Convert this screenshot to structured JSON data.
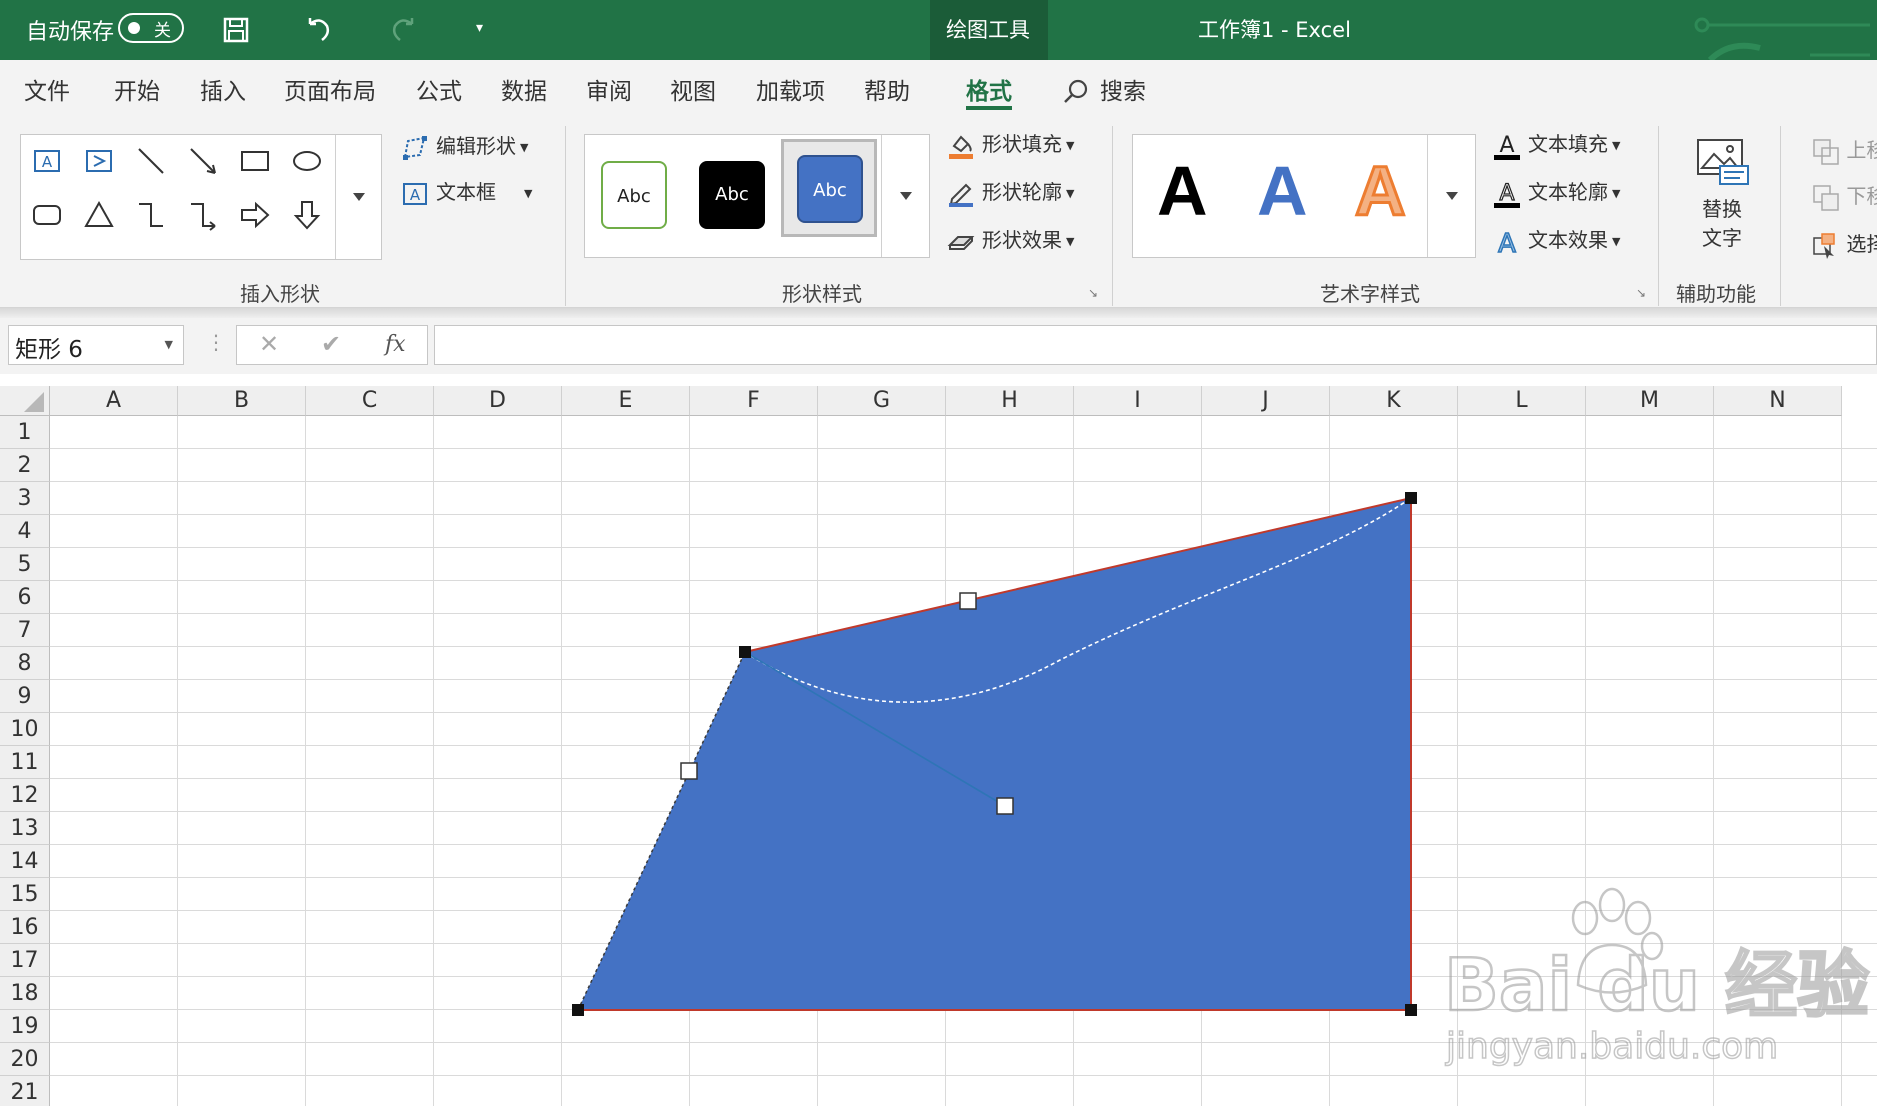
{
  "title_bar": {
    "autosave_label": "自动保存",
    "autosave_state": "关",
    "context_tab": "绘图工具",
    "document_title": "工作簿1  -  Excel"
  },
  "menu_tabs": [
    "文件",
    "开始",
    "插入",
    "页面布局",
    "公式",
    "数据",
    "审阅",
    "视图",
    "加载项",
    "帮助",
    "格式"
  ],
  "active_tab": "格式",
  "search_label": "搜索",
  "ribbon": {
    "insert_shapes": {
      "label": "插入形状",
      "edit_shape": "编辑形状",
      "text_box": "文本框"
    },
    "shape_styles": {
      "label": "形状样式",
      "samples": [
        "Abc",
        "Abc",
        "Abc"
      ],
      "fill": "形状填充",
      "outline": "形状轮廓",
      "effects": "形状效果"
    },
    "wordart_styles": {
      "label": "艺术字样式",
      "samples": [
        "A",
        "A",
        "A"
      ],
      "text_fill": "文本填充",
      "text_outline": "文本轮廓",
      "text_effects": "文本效果"
    },
    "accessibility": {
      "label": "辅助功能",
      "alt_text_line1": "替换",
      "alt_text_line2": "文字"
    },
    "arrange_partial": [
      "上移",
      "下移",
      "选择"
    ]
  },
  "formula_bar": {
    "name_box": "矩形 6",
    "fx": "fx",
    "formula": ""
  },
  "grid": {
    "columns": [
      "A",
      "B",
      "C",
      "D",
      "E",
      "F",
      "G",
      "H",
      "I",
      "J",
      "K",
      "L",
      "M",
      "N"
    ],
    "rows": [
      "1",
      "2",
      "3",
      "4",
      "5",
      "6",
      "7",
      "8",
      "9",
      "10",
      "11",
      "12",
      "13",
      "14",
      "15",
      "16",
      "17",
      "18",
      "19",
      "20",
      "21"
    ]
  },
  "colors": {
    "excel_green": "#217346",
    "shape_fill": "#4472C4",
    "shape_outline": "#C0392B"
  },
  "watermark": {
    "brand": "Bai du 经验",
    "url": "jingyan.baidu.com"
  }
}
